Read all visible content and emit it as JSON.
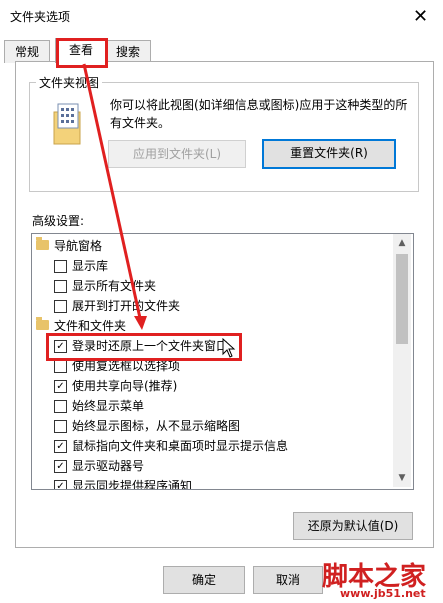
{
  "window": {
    "title": "文件夹选项",
    "close": "✕"
  },
  "tabs": [
    {
      "label": "常规"
    },
    {
      "label": "查看"
    },
    {
      "label": "搜索"
    }
  ],
  "folder_view": {
    "group_title": "文件夹视图",
    "description": "你可以将此视图(如详细信息或图标)应用于这种类型的所有文件夹。",
    "apply_button": "应用到文件夹(L)",
    "reset_button": "重置文件夹(R)"
  },
  "advanced": {
    "label": "高级设置:",
    "items": [
      {
        "text": "导航窗格",
        "type": "folder"
      },
      {
        "text": "显示库",
        "type": "check",
        "checked": false
      },
      {
        "text": "显示所有文件夹",
        "type": "check",
        "checked": false
      },
      {
        "text": "展开到打开的文件夹",
        "type": "check",
        "checked": false
      },
      {
        "text": "文件和文件夹",
        "type": "folder"
      },
      {
        "text": "登录时还原上一个文件夹窗口",
        "type": "check",
        "checked": true
      },
      {
        "text": "使用复选框以选择项",
        "type": "check",
        "checked": false
      },
      {
        "text": "使用共享向导(推荐)",
        "type": "check",
        "checked": true
      },
      {
        "text": "始终显示菜单",
        "type": "check",
        "checked": false
      },
      {
        "text": "始终显示图标，从不显示缩略图",
        "type": "check",
        "checked": false
      },
      {
        "text": "鼠标指向文件夹和桌面项时显示提示信息",
        "type": "check",
        "checked": true
      },
      {
        "text": "显示驱动器号",
        "type": "check",
        "checked": true
      },
      {
        "text": "显示同步提供程序通知",
        "type": "check",
        "checked": true
      }
    ]
  },
  "restore_defaults": "还原为默认值(D)",
  "footer": {
    "ok": "确定",
    "cancel": "取消"
  },
  "watermark": {
    "text": "脚本之家",
    "url": "www.jb51.net"
  },
  "colors": {
    "highlight": "#e02020",
    "focus": "#0078d7"
  }
}
